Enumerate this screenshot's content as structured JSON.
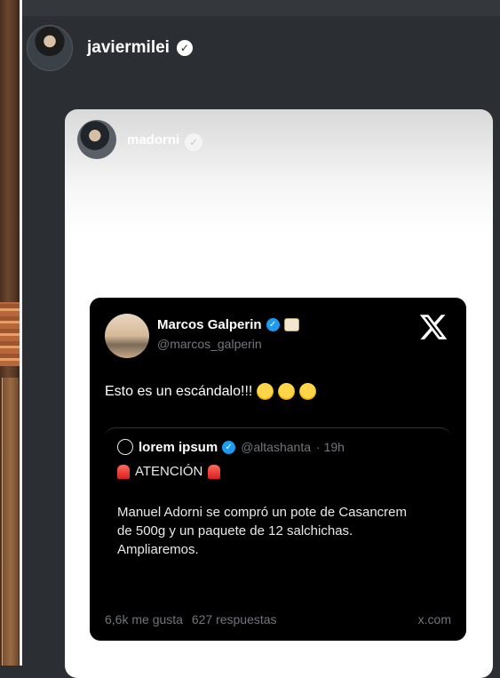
{
  "post": {
    "username": "javiermilei"
  },
  "embed": {
    "username": "madorni"
  },
  "tweet": {
    "author_name": "Marcos Galperin",
    "author_handle": "@marcos_galperin",
    "text": "Esto es un escándalo!!!",
    "emojis": [
      "rolling-on-floor-laughing",
      "rolling-on-floor-laughing",
      "rolling-on-floor-laughing"
    ],
    "quote": {
      "author_name": "lorem ipsum",
      "author_handle": "@altashanta",
      "time": "· 19h",
      "attention": "ATENCIÓN",
      "body": "Manuel Adorni se compró un pote de Casancrem de 500g y un paquete de 12 salchichas. Ampliaremos."
    },
    "likes": "6,6k me gusta",
    "replies": "627 respuestas",
    "domain": "x.com"
  },
  "colors": {
    "background": "#2b2f33",
    "tweet_bg": "#000000",
    "verified_blue": "#1d9bf0",
    "muted_text": "#71767b"
  },
  "icons": [
    "verified-badge-icon",
    "x-logo-icon",
    "siren-icon",
    "laughing-emoji-icon"
  ]
}
